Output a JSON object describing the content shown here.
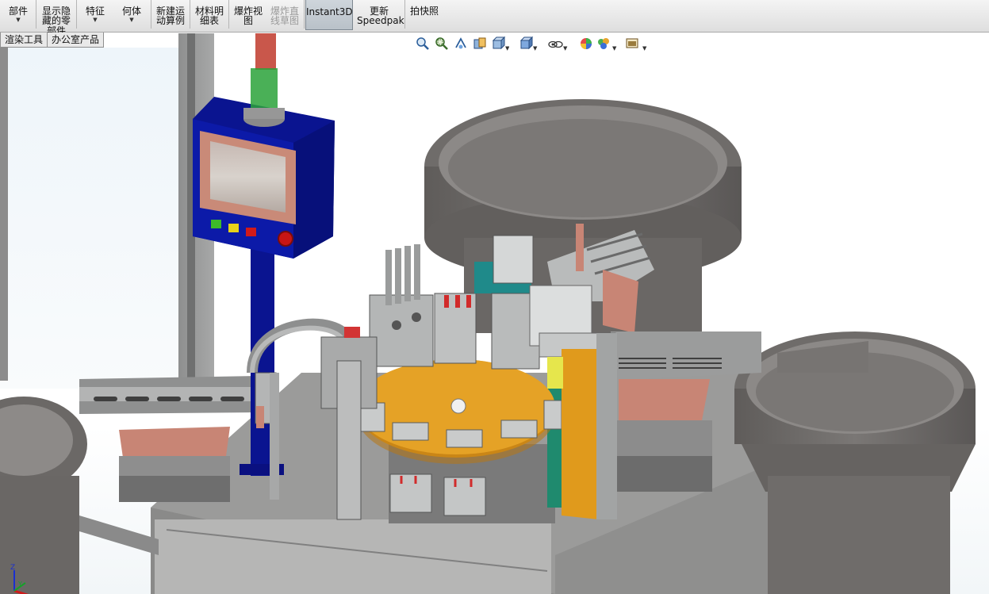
{
  "ribbon": {
    "buttons": [
      {
        "label": "部件",
        "has_dropdown": true
      },
      {
        "label": "显示隐\n藏的零\n部件",
        "has_dropdown": false
      },
      {
        "label": "特征",
        "has_dropdown": true
      },
      {
        "label": "何体",
        "has_dropdown": true
      },
      {
        "label": "新建运\n动算例",
        "has_dropdown": false
      },
      {
        "label": "材料明\n细表",
        "has_dropdown": false
      },
      {
        "label": "爆炸视\n图",
        "has_dropdown": false
      },
      {
        "label": "爆炸直\n线草图",
        "has_dropdown": false,
        "disabled": true
      },
      {
        "label": "Instant3D",
        "has_dropdown": false,
        "active": true
      },
      {
        "label": "更新\nSpeedpak",
        "has_dropdown": false
      },
      {
        "label": "拍快照",
        "has_dropdown": false
      }
    ]
  },
  "tabs": [
    {
      "label": "渲染工具"
    },
    {
      "label": "办公室产品"
    }
  ],
  "view_toolbar": {
    "icons": [
      "zoom-to-fit-icon",
      "zoom-to-area-icon",
      "previous-view-icon",
      "section-view-icon",
      "view-orientation-icon",
      "display-style-icon",
      "hide-show-items-icon",
      "edit-appearance-icon",
      "apply-scene-icon",
      "view-settings-icon"
    ]
  },
  "colors": {
    "hmi_blue": "#0a1490",
    "turntable_orange": "#e09a1c",
    "bowl_gray": "#6f6c6a",
    "chute_copper": "#c98a78",
    "signal_red": "#d22020",
    "signal_green": "#2aa23a"
  }
}
